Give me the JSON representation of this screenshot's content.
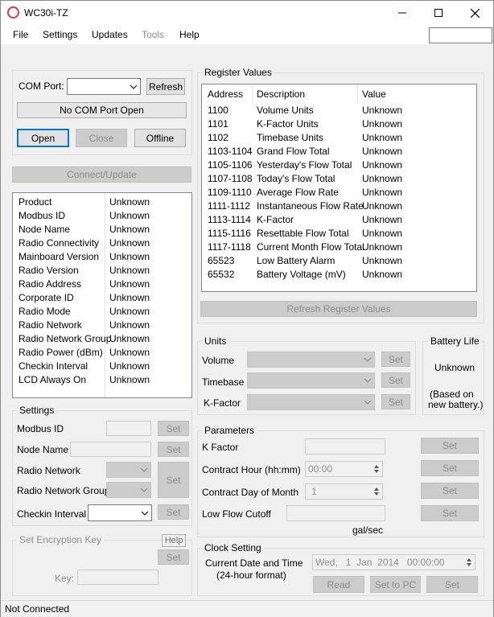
{
  "window": {
    "title": "WC30i-TZ"
  },
  "menu": {
    "items": [
      "File",
      "Settings",
      "Updates",
      "Tools",
      "Help"
    ]
  },
  "connection": {
    "com_port_label": "COM Port:",
    "refresh": "Refresh",
    "status": "No COM Port Open",
    "open": "Open",
    "close": "Close",
    "offline": "Offline",
    "connect_update": "Connect/Update"
  },
  "device_info": [
    {
      "name": "Product",
      "value": "Unknown"
    },
    {
      "name": "Modbus ID",
      "value": "Unknown"
    },
    {
      "name": "Node Name",
      "value": "Unknown"
    },
    {
      "name": "Radio Connectivity",
      "value": "Unknown"
    },
    {
      "name": "Mainboard Version",
      "value": "Unknown"
    },
    {
      "name": "Radio Version",
      "value": "Unknown"
    },
    {
      "name": "Radio Address",
      "value": "Unknown"
    },
    {
      "name": "Corporate ID",
      "value": "Unknown"
    },
    {
      "name": "Radio Mode",
      "value": "Unknown"
    },
    {
      "name": "Radio Network",
      "value": "Unknown"
    },
    {
      "name": "Radio Network Group",
      "value": "Unknown"
    },
    {
      "name": "Radio Power (dBm)",
      "value": "Unknown"
    },
    {
      "name": "Checkin Interval",
      "value": "Unknown"
    },
    {
      "name": "LCD Always On",
      "value": "Unknown"
    }
  ],
  "settings": {
    "title": "Settings",
    "modbus_id": "Modbus ID",
    "node_name": "Node Name",
    "radio_network": "Radio Network",
    "radio_network_group": "Radio Network Group",
    "checkin_interval": "Checkin Interval",
    "set": "Set"
  },
  "encryption": {
    "title": "Set Encryption Key",
    "help": "Help",
    "set": "Set",
    "key_label": "Key:"
  },
  "registers": {
    "title": "Register Values",
    "headers": [
      "Address",
      "Description",
      "Value"
    ],
    "rows": [
      {
        "address": "1100",
        "description": "Volume Units",
        "value": "Unknown"
      },
      {
        "address": "1101",
        "description": "K-Factor Units",
        "value": "Unknown"
      },
      {
        "address": "1102",
        "description": "Timebase Units",
        "value": "Unknown"
      },
      {
        "address": "1103-1104",
        "description": "Grand Flow Total",
        "value": "Unknown"
      },
      {
        "address": "1105-1106",
        "description": "Yesterday's Flow Total",
        "value": "Unknown"
      },
      {
        "address": "1107-1108",
        "description": "Today's Flow Total",
        "value": "Unknown"
      },
      {
        "address": "1109-1110",
        "description": "Average Flow Rate",
        "value": "Unknown"
      },
      {
        "address": "1111-1112",
        "description": "Instantaneous Flow Rate",
        "value": "Unknown"
      },
      {
        "address": "1113-1114",
        "description": "K-Factor",
        "value": "Unknown"
      },
      {
        "address": "1115-1116",
        "description": "Resettable Flow Total",
        "value": "Unknown"
      },
      {
        "address": "1117-1118",
        "description": "Current Month Flow Total",
        "value": "Unknown"
      },
      {
        "address": "65523",
        "description": "Low Battery Alarm",
        "value": "Unknown"
      },
      {
        "address": "65532",
        "description": "Battery Voltage (mV)",
        "value": "Unknown"
      }
    ],
    "refresh": "Refresh Register Values"
  },
  "units": {
    "title": "Units",
    "volume": "Volume",
    "timebase": "Timebase",
    "kfactor": "K-Factor",
    "set": "Set"
  },
  "battery": {
    "title": "Battery Life",
    "value": "Unknown",
    "note_line1": "(Based on",
    "note_line2": "new battery.)"
  },
  "parameters": {
    "title": "Parameters",
    "kfactor": "K Factor",
    "contract_hour": "Contract Hour (hh:mm)",
    "contract_hour_value": "00:00",
    "contract_day": "Contract Day of Month",
    "contract_day_value": "1",
    "low_flow": "Low Flow Cutoff",
    "low_flow_unit": "gal/sec",
    "set": "Set"
  },
  "clock": {
    "title": "Clock Setting",
    "label_line1": "Current Date and Time",
    "label_line2": "(24-hour format)",
    "value": "Wed,   1  Jan  2014   00:00:00",
    "read": "Read",
    "set_to_pc": "Set to PC",
    "set": "Set"
  },
  "status": {
    "text": "Not Connected"
  }
}
